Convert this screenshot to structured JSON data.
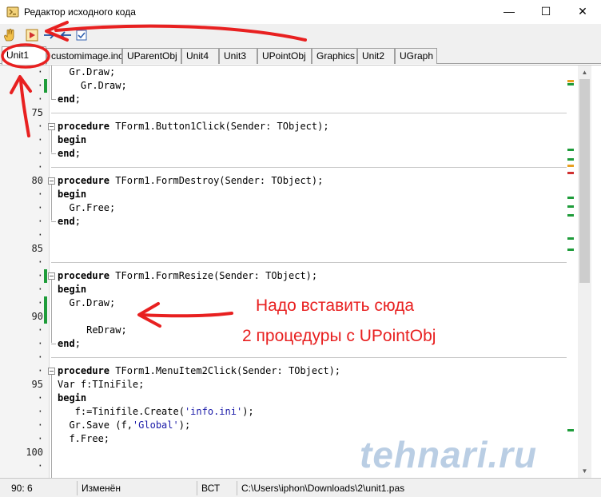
{
  "window": {
    "title": "Редактор исходного кода",
    "minimize": "—",
    "maximize": "☐",
    "close": "✕"
  },
  "tabs": [
    {
      "label": "Unit1",
      "active": true
    },
    {
      "label": "customimage.inc",
      "active": false
    },
    {
      "label": "UParentObj",
      "active": false
    },
    {
      "label": "Unit4",
      "active": false
    },
    {
      "label": "Unit3",
      "active": false
    },
    {
      "label": "UPointObj",
      "active": false
    },
    {
      "label": "Graphics",
      "active": false
    },
    {
      "label": "Unit2",
      "active": false
    },
    {
      "label": "UGraph",
      "active": false
    }
  ],
  "gutter": [
    "·",
    "·",
    "·",
    "75",
    "·",
    "·",
    "·",
    "·",
    "80",
    "·",
    "·",
    "·",
    "·",
    "85",
    "·",
    "·",
    "·",
    "·",
    "90",
    "·",
    "·",
    "·",
    "·",
    "95",
    "·",
    "·",
    "·",
    "·",
    "100",
    "·"
  ],
  "code": [
    {
      "kw": "",
      "text": "  Gr.Draw;"
    },
    {
      "kw": "",
      "text": "    Gr.Draw;"
    },
    {
      "kw": "end",
      "text": ";"
    },
    {
      "kw": "",
      "text": ""
    },
    {
      "kw": "procedure",
      "text": " TForm1.Button1Click(Sender: TObject);"
    },
    {
      "kw": "begin",
      "text": ""
    },
    {
      "kw": "end",
      "text": ";"
    },
    {
      "kw": "",
      "text": ""
    },
    {
      "kw": "procedure",
      "text": " TForm1.FormDestroy(Sender: TObject);"
    },
    {
      "kw": "begin",
      "text": ""
    },
    {
      "kw": "",
      "text": "  Gr.Free;"
    },
    {
      "kw": "end",
      "text": ";"
    },
    {
      "kw": "",
      "text": ""
    },
    {
      "kw": "",
      "text": ""
    },
    {
      "kw": "",
      "text": ""
    },
    {
      "kw": "procedure",
      "text": " TForm1.FormResize(Sender: TObject);"
    },
    {
      "kw": "begin",
      "text": ""
    },
    {
      "kw": "",
      "text": "  Gr.Draw;"
    },
    {
      "kw": "",
      "text": ""
    },
    {
      "kw": "",
      "text": "     ReDraw;"
    },
    {
      "kw": "end",
      "text": ";"
    },
    {
      "kw": "",
      "text": ""
    },
    {
      "kw": "procedure",
      "text": " TForm1.MenuItem2Click(Sender: TObject);"
    },
    {
      "kw": "",
      "text": "Var f:TIniFile;"
    },
    {
      "kw": "begin",
      "text": ""
    },
    {
      "kw": "",
      "text": "   f:=Tinifile.Create('info.ini');"
    },
    {
      "kw": "",
      "text": "  Gr.Save (f,'Global');"
    },
    {
      "kw": "",
      "text": "  f.Free;"
    },
    {
      "kw": "",
      "text": ""
    },
    {
      "kw": "",
      "text": ""
    }
  ],
  "annotations": {
    "line1": "Надо вставить сюда",
    "line2": "2 процедуры с UPointObj"
  },
  "watermark": "tehnari.ru",
  "status": {
    "position": "90:  6",
    "modified": "Изменён",
    "mode": "ВСТ",
    "path": "C:\\Users\\iphon\\Downloads\\2\\unit1.pas"
  },
  "colors": {
    "annotation": "#e82020",
    "modified_marker": "#1e9c3a"
  }
}
